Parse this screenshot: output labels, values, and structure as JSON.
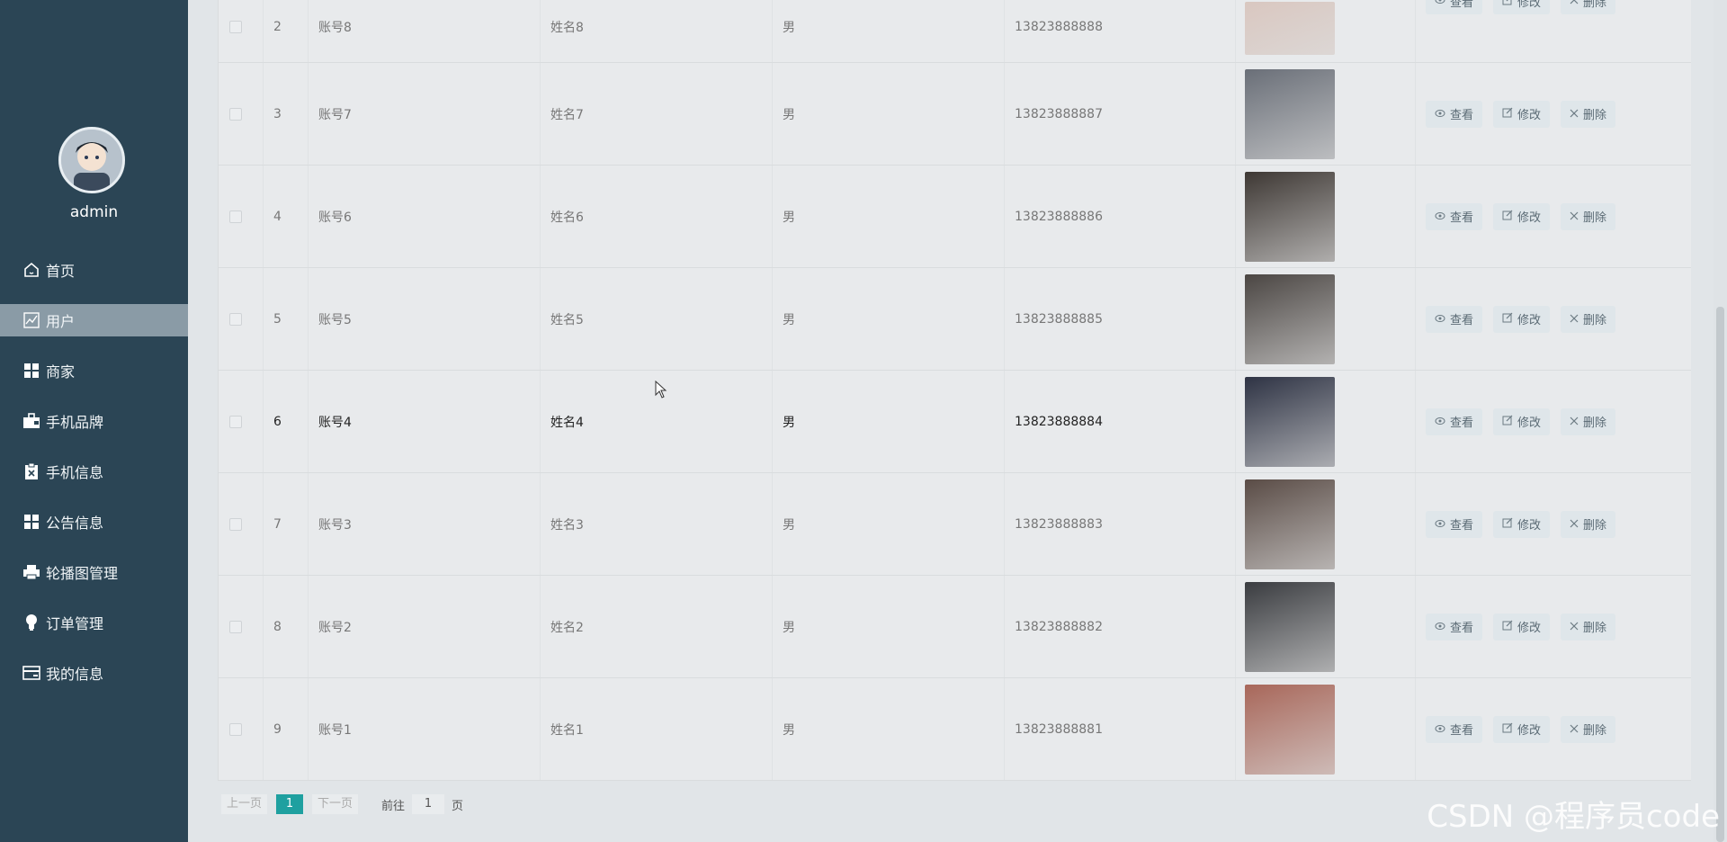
{
  "sidebar": {
    "username": "admin",
    "items": [
      {
        "label": "首页",
        "icon": "home-icon"
      },
      {
        "label": "用户",
        "icon": "chart-icon"
      },
      {
        "label": "商家",
        "icon": "grid-icon"
      },
      {
        "label": "手机品牌",
        "icon": "briefcase-icon"
      },
      {
        "label": "手机信息",
        "icon": "clipboard-icon"
      },
      {
        "label": "公告信息",
        "icon": "grid-icon"
      },
      {
        "label": "轮播图管理",
        "icon": "printer-icon"
      },
      {
        "label": "订单管理",
        "icon": "bulb-icon"
      },
      {
        "label": "我的信息",
        "icon": "card-icon"
      }
    ],
    "active_index": 1
  },
  "table": {
    "actions": {
      "view": "查看",
      "edit": "修改",
      "delete": "删除"
    },
    "rows": [
      {
        "index": "2",
        "account": "账号8",
        "name": "姓名8",
        "sex": "男",
        "phone": "13823888888",
        "photo_color": "#d9c7c0"
      },
      {
        "index": "3",
        "account": "账号7",
        "name": "姓名7",
        "sex": "男",
        "phone": "13823888887",
        "photo_color": "#6a6f78"
      },
      {
        "index": "4",
        "account": "账号6",
        "name": "姓名6",
        "sex": "男",
        "phone": "13823888886",
        "photo_color": "#3e3834"
      },
      {
        "index": "5",
        "account": "账号5",
        "name": "姓名5",
        "sex": "男",
        "phone": "13823888885",
        "photo_color": "#4b4643"
      },
      {
        "index": "6",
        "account": "账号4",
        "name": "姓名4",
        "sex": "男",
        "phone": "13823888884",
        "photo_color": "#2e3344"
      },
      {
        "index": "7",
        "account": "账号3",
        "name": "姓名3",
        "sex": "男",
        "phone": "13823888883",
        "photo_color": "#5a4c46"
      },
      {
        "index": "8",
        "account": "账号2",
        "name": "姓名2",
        "sex": "男",
        "phone": "13823888882",
        "photo_color": "#3a3c40"
      },
      {
        "index": "9",
        "account": "账号1",
        "name": "姓名1",
        "sex": "男",
        "phone": "13823888881",
        "photo_color": "#a8675a"
      }
    ],
    "highlighted_row": 4
  },
  "pagination": {
    "prev": "上一页",
    "current": "1",
    "next": "下一页",
    "goto": "前往",
    "goto_value": "1",
    "unit": "页"
  },
  "watermark": "CSDN @程序员code"
}
